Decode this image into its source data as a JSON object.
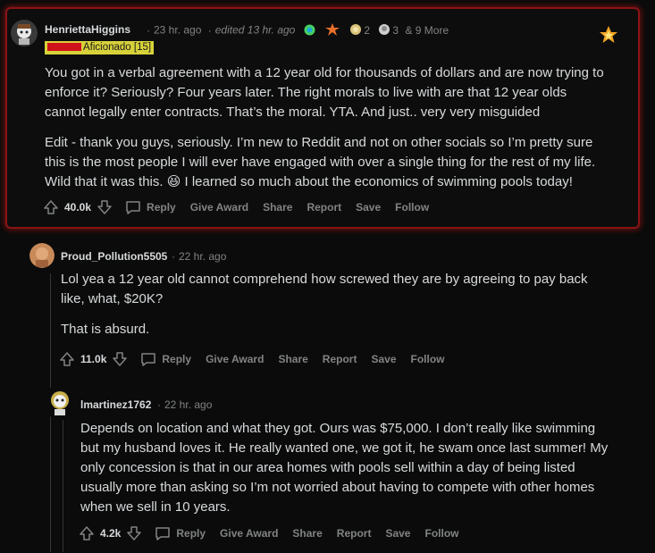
{
  "comments": [
    {
      "username": "HenriettaHiggins",
      "time": "23 hr. ago",
      "edited": "edited 13 hr. ago",
      "awards": [
        {
          "icon": "helpful-award-icon",
          "count": ""
        },
        {
          "icon": "fire-award-icon",
          "count": ""
        },
        {
          "icon": "gold-award-icon",
          "count": "2"
        },
        {
          "icon": "hug-award-icon",
          "count": "3"
        }
      ],
      "more": "& 9 More",
      "flair": "Aficionado [15]",
      "paragraphs": [
        "You got in a verbal agreement with a 12 year old for thousands of dollars and are now trying to enforce it? Seriously? Four years later. The right morals to live with are that 12 year olds cannot legally enter contracts. That’s the moral. YTA. And just.. very very misguided",
        "Edit - thank you guys, seriously. I’m new to Reddit and not on other socials so I’m pretty sure this is the most people I will ever have engaged with over a single thing for the rest of my life. Wild that it was this. 😆 I learned so much about the economics of swimming pools today!"
      ],
      "score": "40.0k"
    },
    {
      "username": "Proud_Pollution5505",
      "time": "22 hr. ago",
      "paragraphs": [
        "Lol yea a 12 year old cannot comprehend how screwed they are by agreeing to pay back like, what, $20K?",
        "That is absurd."
      ],
      "score": "11.0k"
    },
    {
      "username": "lmartinez1762",
      "time": "22 hr. ago",
      "paragraphs": [
        "Depends on location and what they got. Ours was $75,000. I don’t really like swimming but my husband loves it. He really wanted one, we got it, he swam once last summer! My only concession is that in our area homes with pools sell within a day of being listed usually more than asking so I’m not worried about having to compete with other homes when we sell in 10 years."
      ],
      "score": "4.2k"
    }
  ],
  "actions": {
    "reply": "Reply",
    "give_award": "Give Award",
    "share": "Share",
    "report": "Report",
    "save": "Save",
    "follow": "Follow"
  },
  "colors": {
    "highlight_border": "#8a1414",
    "flair_bg": "#d8d23a",
    "meta": "#818384",
    "text": "#d7dadc"
  }
}
